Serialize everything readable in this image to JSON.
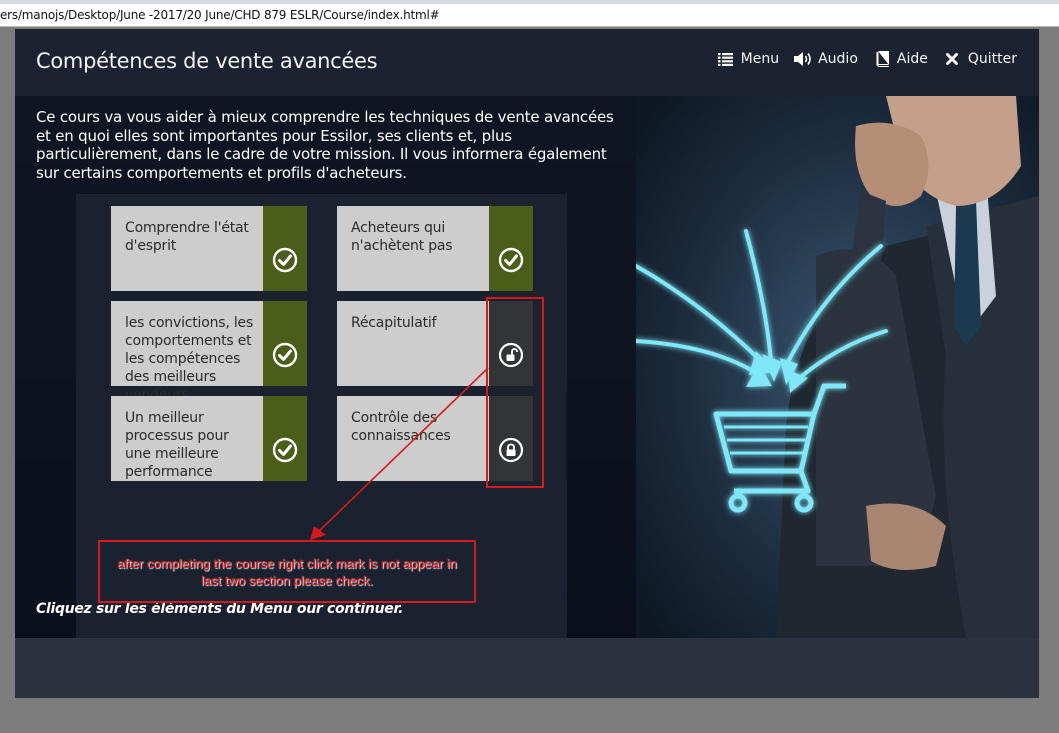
{
  "browser": {
    "address": "ers/manojs/Desktop/June -2017/20 June/CHD 879 ESLR/Course/index.html#"
  },
  "header": {
    "title": "Compétences de vente avancées",
    "nav": [
      {
        "label": "Menu",
        "icon": "list-icon"
      },
      {
        "label": "Audio",
        "icon": "speaker-icon"
      },
      {
        "label": "Aide",
        "icon": "book-icon"
      },
      {
        "label": "Quitter",
        "icon": "close-icon"
      }
    ]
  },
  "main": {
    "intro": "Ce cours va vous aider à mieux comprendre les techniques de vente avancées et en quoi elles sont importantes pour Essilor, ses clients et, plus particulièrement, dans le cadre de votre mission. Il vous informera également sur certains comportements et profils d'acheteurs.",
    "modules": [
      {
        "label": "Comprendre l'état d'esprit",
        "status": "completed",
        "icon": "check-circle-icon"
      },
      {
        "label": "Acheteurs qui n'achètent pas",
        "status": "completed",
        "icon": "check-circle-icon"
      },
      {
        "label": "les convictions, les comportements et les compétences des meilleurs vendeurs",
        "status": "completed",
        "icon": "check-circle-icon"
      },
      {
        "label": "Récapitulatif",
        "status": "unlocked",
        "icon": "unlock-icon"
      },
      {
        "label": "Un meilleur processus pour une meilleure performance",
        "status": "completed",
        "icon": "check-circle-icon"
      },
      {
        "label": "Contrôle des connaissances",
        "status": "locked",
        "icon": "lock-icon"
      }
    ],
    "footer": "Cliquez sur les éléments du Menu our continuer."
  },
  "annotation": {
    "text": "after completing the course right click mark is not appear in last two section please check."
  },
  "colors": {
    "header_bg": "#1b2331",
    "completed": "#4a5e1a",
    "locked": "#333436",
    "tile_bg": "#cdcdcd",
    "annotation": "#d8191b",
    "glow": "#7fe7f7"
  }
}
